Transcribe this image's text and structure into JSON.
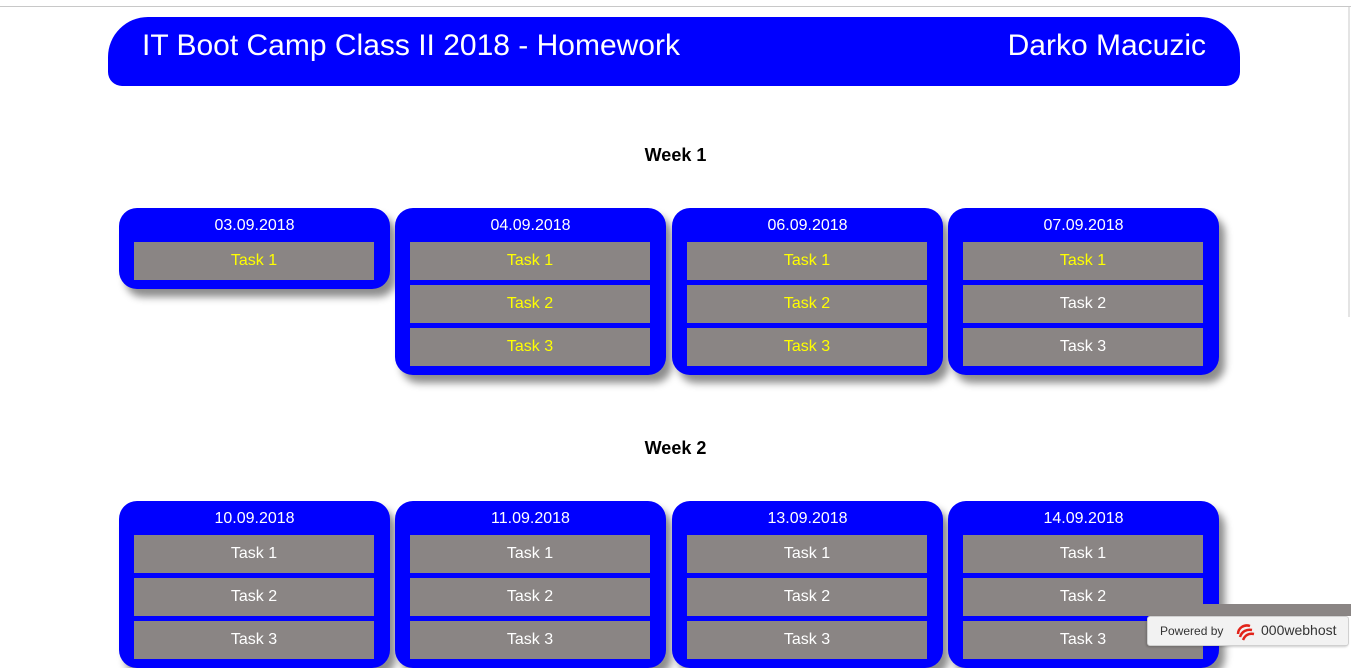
{
  "header": {
    "title": "IT Boot Camp Class II 2018 - Homework",
    "author": "Darko Macuzic"
  },
  "colors": {
    "card": "#0000ff",
    "task_bg": "#8a8584",
    "done_text": "#ffff00",
    "todo_text": "#ffffff"
  },
  "weeks": [
    {
      "heading": "Week 1",
      "days": [
        {
          "date": "03.09.2018",
          "tasks": [
            {
              "label": "Task 1",
              "done": true
            }
          ]
        },
        {
          "date": "04.09.2018",
          "tasks": [
            {
              "label": "Task 1",
              "done": true
            },
            {
              "label": "Task 2",
              "done": true
            },
            {
              "label": "Task 3",
              "done": true
            }
          ]
        },
        {
          "date": "06.09.2018",
          "tasks": [
            {
              "label": "Task 1",
              "done": true
            },
            {
              "label": "Task 2",
              "done": true
            },
            {
              "label": "Task 3",
              "done": true
            }
          ]
        },
        {
          "date": "07.09.2018",
          "tasks": [
            {
              "label": "Task 1",
              "done": true
            },
            {
              "label": "Task 2",
              "done": false
            },
            {
              "label": "Task 3",
              "done": false
            }
          ]
        }
      ]
    },
    {
      "heading": "Week 2",
      "days": [
        {
          "date": "10.09.2018",
          "tasks": [
            {
              "label": "Task 1",
              "done": false
            },
            {
              "label": "Task 2",
              "done": false
            },
            {
              "label": "Task 3",
              "done": false
            }
          ]
        },
        {
          "date": "11.09.2018",
          "tasks": [
            {
              "label": "Task 1",
              "done": false
            },
            {
              "label": "Task 2",
              "done": false
            },
            {
              "label": "Task 3",
              "done": false
            }
          ]
        },
        {
          "date": "13.09.2018",
          "tasks": [
            {
              "label": "Task 1",
              "done": false
            },
            {
              "label": "Task 2",
              "done": false
            },
            {
              "label": "Task 3",
              "done": false
            }
          ]
        },
        {
          "date": "14.09.2018",
          "tasks": [
            {
              "label": "Task 1",
              "done": false
            },
            {
              "label": "Task 2",
              "done": false
            },
            {
              "label": "Task 3",
              "done": false
            }
          ]
        }
      ]
    }
  ],
  "footer_badge": {
    "powered_label": "Powered by",
    "brand": "000webhost",
    "icon": "000webhost-logo-icon"
  }
}
